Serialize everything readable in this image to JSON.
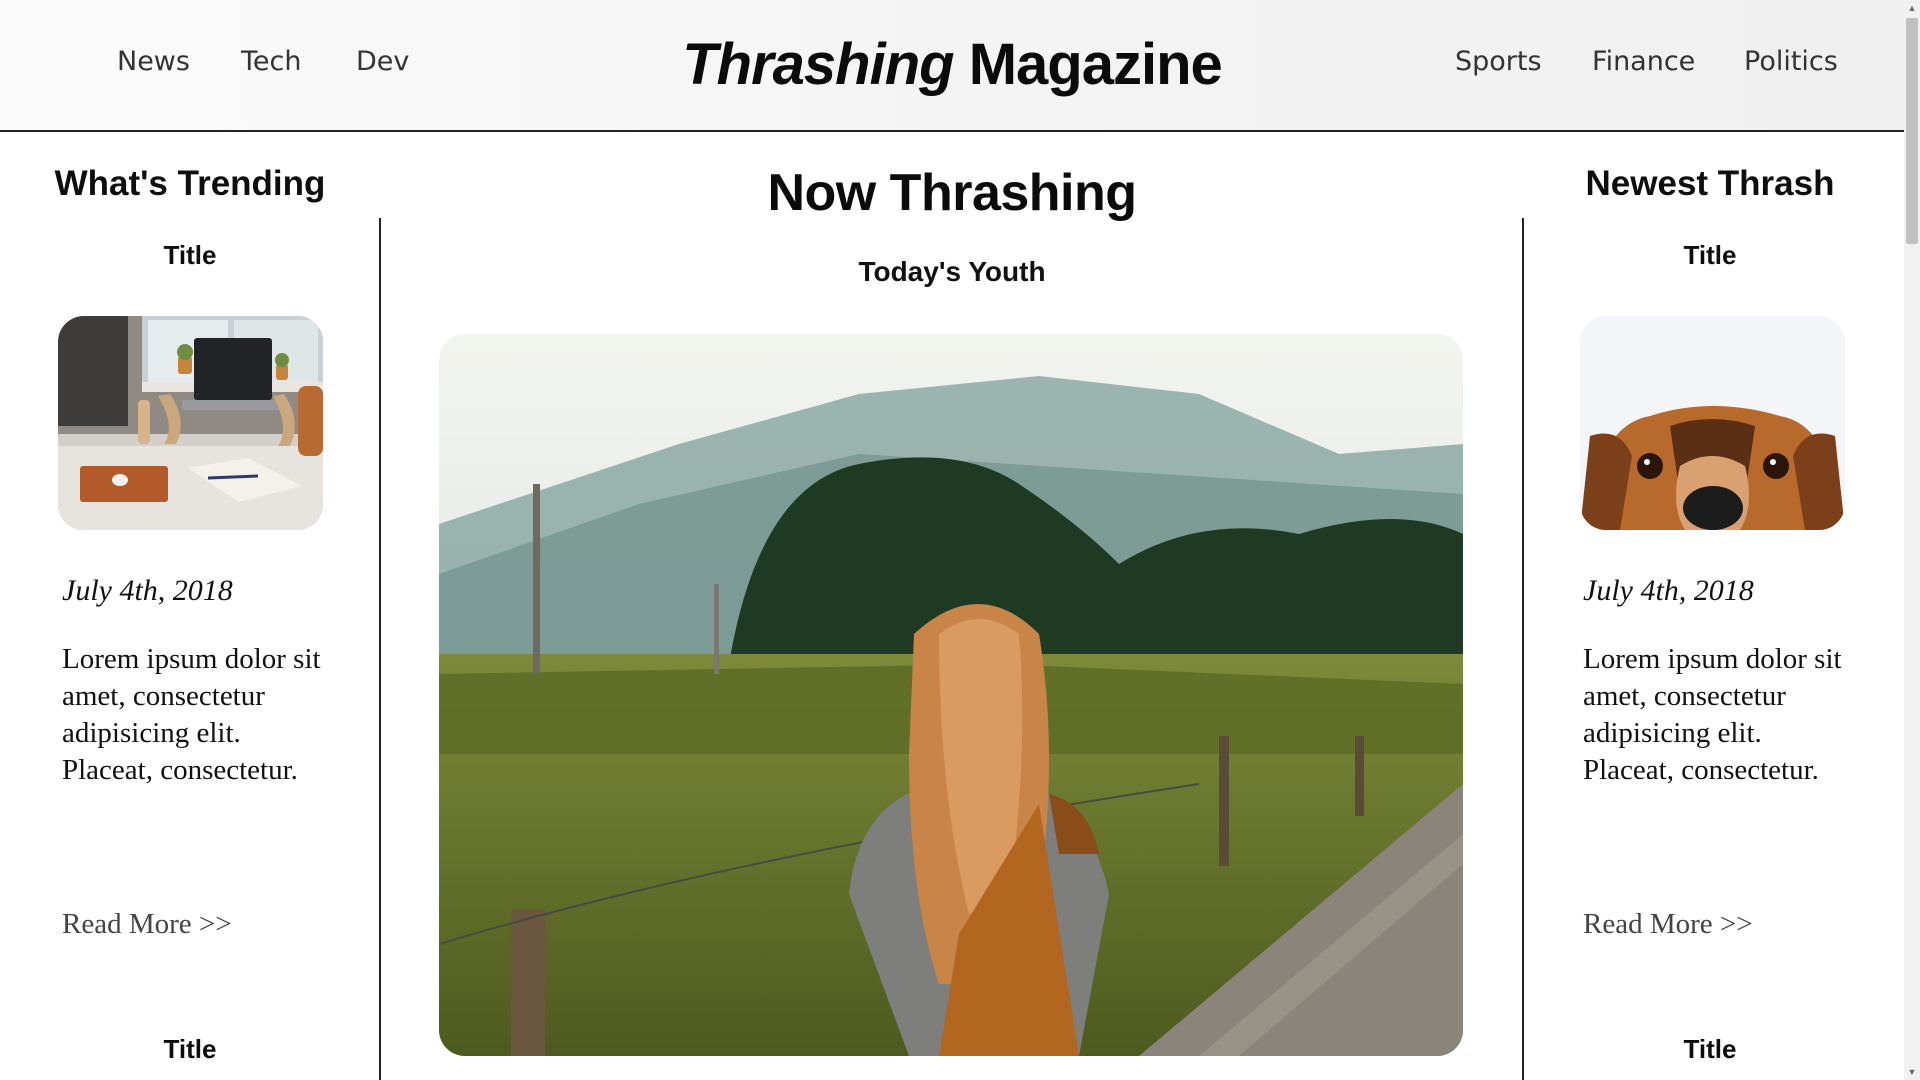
{
  "nav": {
    "left": [
      "News",
      "Tech",
      "Dev"
    ],
    "right": [
      "Sports",
      "Finance",
      "Politics"
    ]
  },
  "brand": {
    "italic": "Thrashing",
    "rest": "Magazine"
  },
  "left_column": {
    "heading": "What's Trending",
    "card": {
      "title": "Title",
      "date": "July 4th, 2018",
      "excerpt": "Lorem ipsum dolor sit amet, consectetur adipisicing elit. Placeat, consectetur.",
      "read_more": "Read More  >>"
    },
    "next_title": "Title"
  },
  "center": {
    "heading": "Now Thrashing",
    "subheading": "Today's Youth"
  },
  "right_column": {
    "heading": "Newest Thrash",
    "card": {
      "title": "Title",
      "date": "July 4th, 2018",
      "excerpt": "Lorem ipsum dolor sit amet, consectetur adipisicing elit. Placeat, consectetur.",
      "read_more": "Read More  >>"
    },
    "next_title": "Title"
  },
  "scrollbar": {
    "up_icon": "▲",
    "down_icon": "▼"
  }
}
